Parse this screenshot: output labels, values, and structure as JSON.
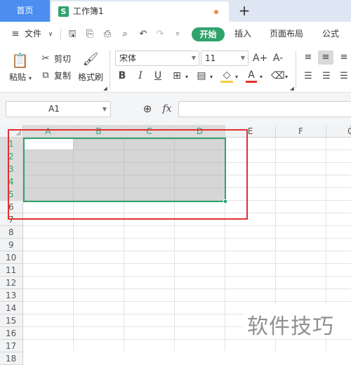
{
  "tabs": {
    "home": "首页",
    "doc_badge": "S",
    "doc_name": "工作簿1",
    "new_tab_icon": "+"
  },
  "menu": {
    "file": "文件",
    "start": "开始",
    "insert": "插入",
    "page_layout": "页面布局",
    "formula": "公式"
  },
  "ribbon": {
    "paste": "粘贴",
    "cut": "剪切",
    "copy": "复制",
    "format_painter": "格式刷",
    "font_name": "宋体",
    "font_size": "11",
    "grow_font": "A+",
    "shrink_font": "A-",
    "bold": "B",
    "italic": "I",
    "underline": "U"
  },
  "formula_bar": {
    "name_box": "A1",
    "fx": "fx",
    "content": ""
  },
  "grid": {
    "columns": [
      "A",
      "B",
      "C",
      "D",
      "E",
      "F",
      "G"
    ],
    "rows": [
      "1",
      "2",
      "3",
      "4",
      "5",
      "6",
      "7",
      "8",
      "9",
      "10",
      "11",
      "12",
      "13",
      "14",
      "15",
      "16",
      "17",
      "18"
    ],
    "selected_range": "A1:D5"
  },
  "watermark": "软件技巧",
  "colors": {
    "accent_green": "#2fa36b",
    "home_tab_blue": "#4b8ef0",
    "annotation_red": "#e03030"
  }
}
